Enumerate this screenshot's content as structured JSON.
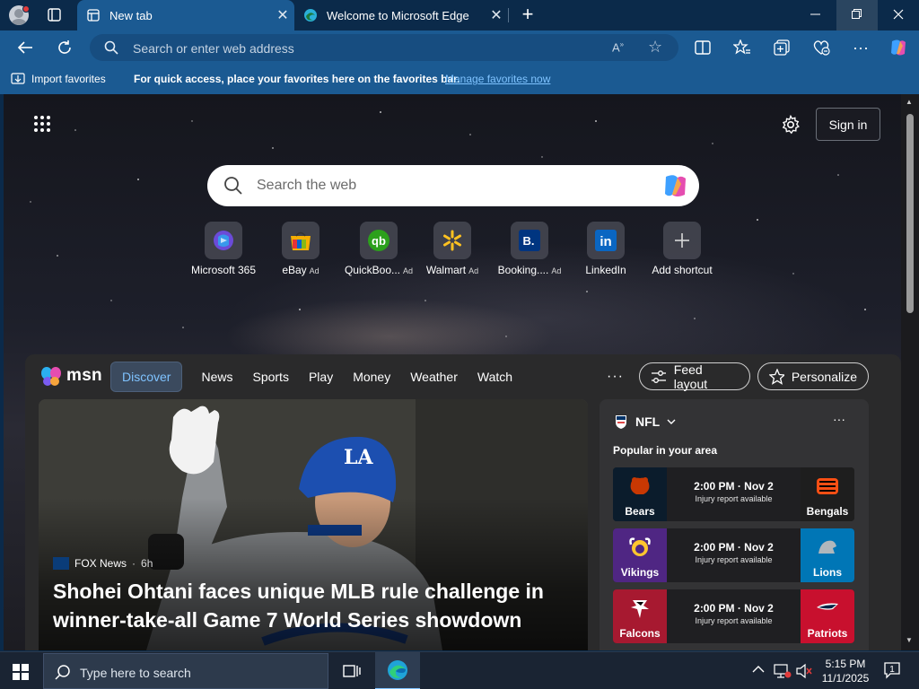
{
  "browser": {
    "tabs": [
      {
        "label": "New tab",
        "active": true
      },
      {
        "label": "Welcome to Microsoft Edge",
        "active": false
      }
    ],
    "address_placeholder": "Search or enter web address",
    "favorites_bar": {
      "import_label": "Import favorites",
      "message": "For quick access, place your favorites here on the favorites bar.",
      "manage_link": "Manage favorites now"
    }
  },
  "newtab": {
    "sign_in": "Sign in",
    "search_placeholder": "Search the web",
    "shortcuts": [
      {
        "name": "Microsoft 365",
        "ad": "",
        "icon": "microsoft-365-icon"
      },
      {
        "name": "eBay",
        "ad": "Ad",
        "icon": "ebay-icon"
      },
      {
        "name": "QuickBoo...",
        "ad": "Ad",
        "icon": "quickbooks-icon"
      },
      {
        "name": "Walmart",
        "ad": "Ad",
        "icon": "walmart-icon"
      },
      {
        "name": "Booking....",
        "ad": "Ad",
        "icon": "booking-icon"
      },
      {
        "name": "LinkedIn",
        "ad": "",
        "icon": "linkedin-icon"
      },
      {
        "name": "Add shortcut",
        "ad": "",
        "icon": "plus-icon"
      }
    ]
  },
  "msn": {
    "logo_text": "msn",
    "tabs": [
      "Discover",
      "News",
      "Sports",
      "Play",
      "Money",
      "Weather",
      "Watch"
    ],
    "more": "···",
    "feed_layout": "Feed layout",
    "personalize": "Personalize",
    "hero": {
      "source": "FOX News",
      "age": "6h",
      "headline": "Shohei Ohtani faces unique MLB rule challenge in winner-take-all Game 7 World Series showdown"
    },
    "nfl": {
      "title": "NFL",
      "subtitle": "Popular in your area",
      "games": [
        {
          "home": "Bears",
          "away": "Bengals",
          "time": "2:00 PM · Nov 2",
          "note": "Injury report available",
          "left_color": "#0b1c2c",
          "right_color": "#1e1e1e"
        },
        {
          "home": "Vikings",
          "away": "Lions",
          "time": "2:00 PM · Nov 2",
          "note": "Injury report available",
          "left_color": "#4f2683",
          "right_color": "#0076b6"
        },
        {
          "home": "Falcons",
          "away": "Patriots",
          "time": "2:00 PM · Nov 2",
          "note": "Injury report available",
          "left_color": "#a71930",
          "right_color": "#c8102e"
        }
      ]
    }
  },
  "taskbar": {
    "search_placeholder": "Type here to search",
    "time": "5:15 PM",
    "date": "11/1/2025",
    "notification_count": "1"
  },
  "colors": {
    "titlebar": "#0b2a4a",
    "toolbar": "#1b5a92",
    "accent_link": "#7fc3ff",
    "feed_bg": "#2a2a2b"
  }
}
